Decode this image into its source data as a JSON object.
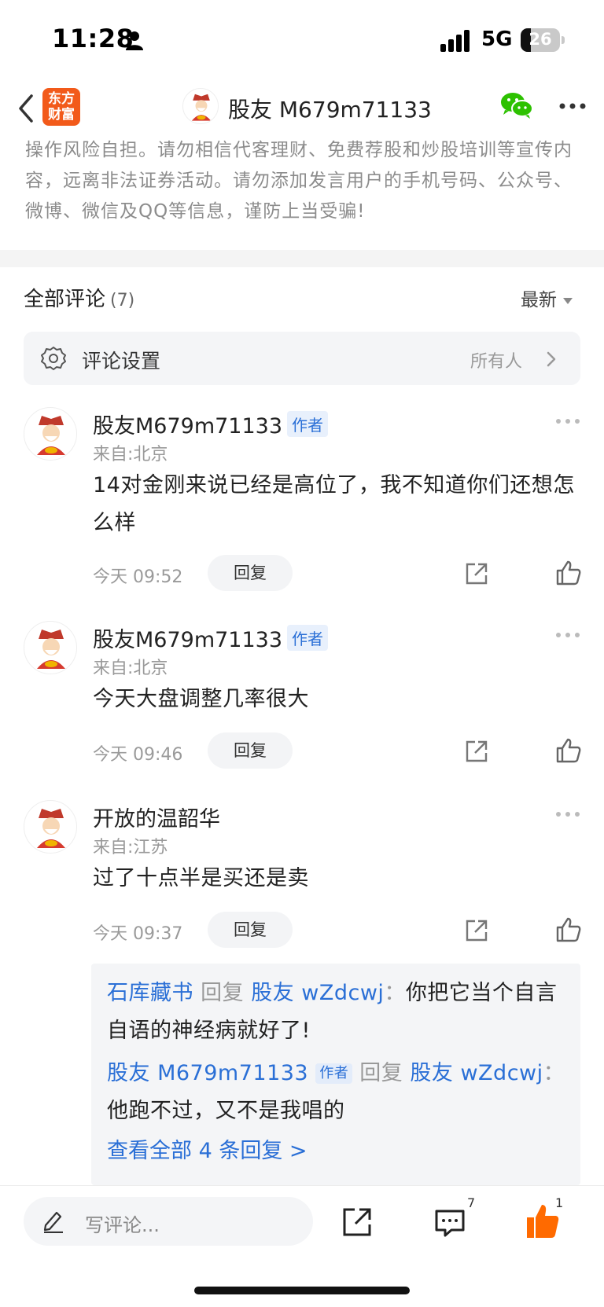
{
  "status_bar": {
    "time": "11:28",
    "network": "5G",
    "battery": "26",
    "battery_level": 0.26
  },
  "nav": {
    "logo_line1": "东方",
    "logo_line2": "财富",
    "title": "股友 M679m71133"
  },
  "disclaimer": "操作风险自担。请勿相信代客理财、免费荐股和炒股培训等宣传内容，远离非法证券活动。请勿添加发言用户的手机号码、公众号、微博、微信及QQ等信息，谨防上当受骗!",
  "comments_header": {
    "title": "全部评论",
    "count": "(7)",
    "sort": "最新"
  },
  "settings": {
    "label": "评论设置",
    "value": "所有人"
  },
  "comments": [
    {
      "name": "股友M679m71133",
      "badge": "作者",
      "location": "来自:北京",
      "text": "14对金刚来说已经是高位了，我不知道你们还想怎么样",
      "time": "今天 09:52",
      "reply_label": "回复"
    },
    {
      "name": "股友M679m71133",
      "badge": "作者",
      "location": "来自:北京",
      "text": "今天大盘调整几率很大",
      "time": "今天 09:46",
      "reply_label": "回复"
    },
    {
      "name": "开放的温韶华",
      "badge": "",
      "location": "来自:江苏",
      "text": "过了十点半是买还是卖",
      "time": "今天 09:37",
      "reply_label": "回复"
    }
  ],
  "replies": [
    {
      "author": "石库藏书",
      "badge": "",
      "verb": "回复",
      "target": "股友 wZdcwj",
      "sep": "：",
      "text": "你把它当个自言自语的神经病就好了!"
    },
    {
      "author": "股友 M679m71133",
      "badge": "作者",
      "verb": "回复",
      "target": "股友 wZdcwj",
      "sep": "：",
      "text": "他跑不过，又不是我唱的"
    }
  ],
  "view_all": "查看全部 4 条回复 >",
  "bottom_bar": {
    "placeholder": "写评论...",
    "comment_count": "7",
    "like_count": "1"
  },
  "colors": {
    "brand": "#f25a1a",
    "link": "#2a6fd6",
    "like_active": "#ff6a00"
  }
}
